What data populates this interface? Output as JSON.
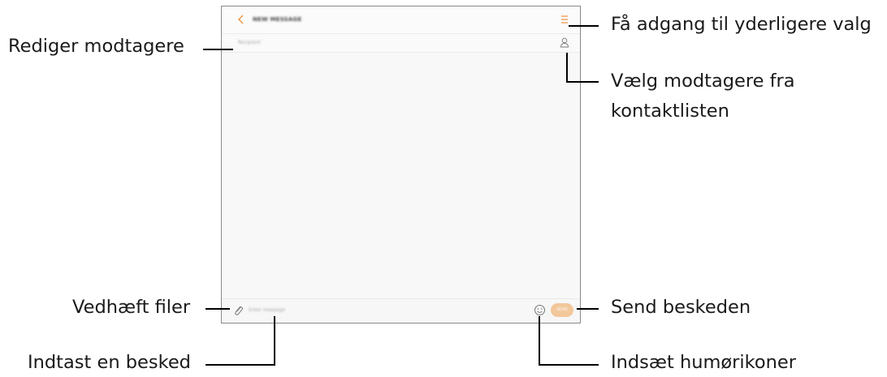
{
  "screen": {
    "header": {
      "title": "NEW MESSAGE",
      "back_icon": "chevron-left-icon",
      "menu_icon": "more-options-icon"
    },
    "recipient": {
      "placeholder": "Recipient",
      "contact_icon": "contact-person-icon"
    },
    "compose": {
      "placeholder": "Enter message",
      "send_label": "SEND",
      "attach_icon": "paperclip-icon",
      "emoji_icon": "smiley-icon"
    },
    "colors": {
      "accent": "#f0903a",
      "send_bg": "#f2c79a",
      "frame": "#8a8a8a",
      "background": "#f9f9f9"
    }
  },
  "callouts": {
    "edit_recipients": "Rediger modtagere",
    "more_options": "Få adgang til yderligere valg",
    "select_contacts_line1": "Vælg modtagere fra",
    "select_contacts_line2": "kontaktlisten",
    "attach_files": "Vedhæft filer",
    "send_message": "Send beskeden",
    "enter_message": "Indtast en besked",
    "insert_emoticons": "Indsæt humørikoner"
  }
}
